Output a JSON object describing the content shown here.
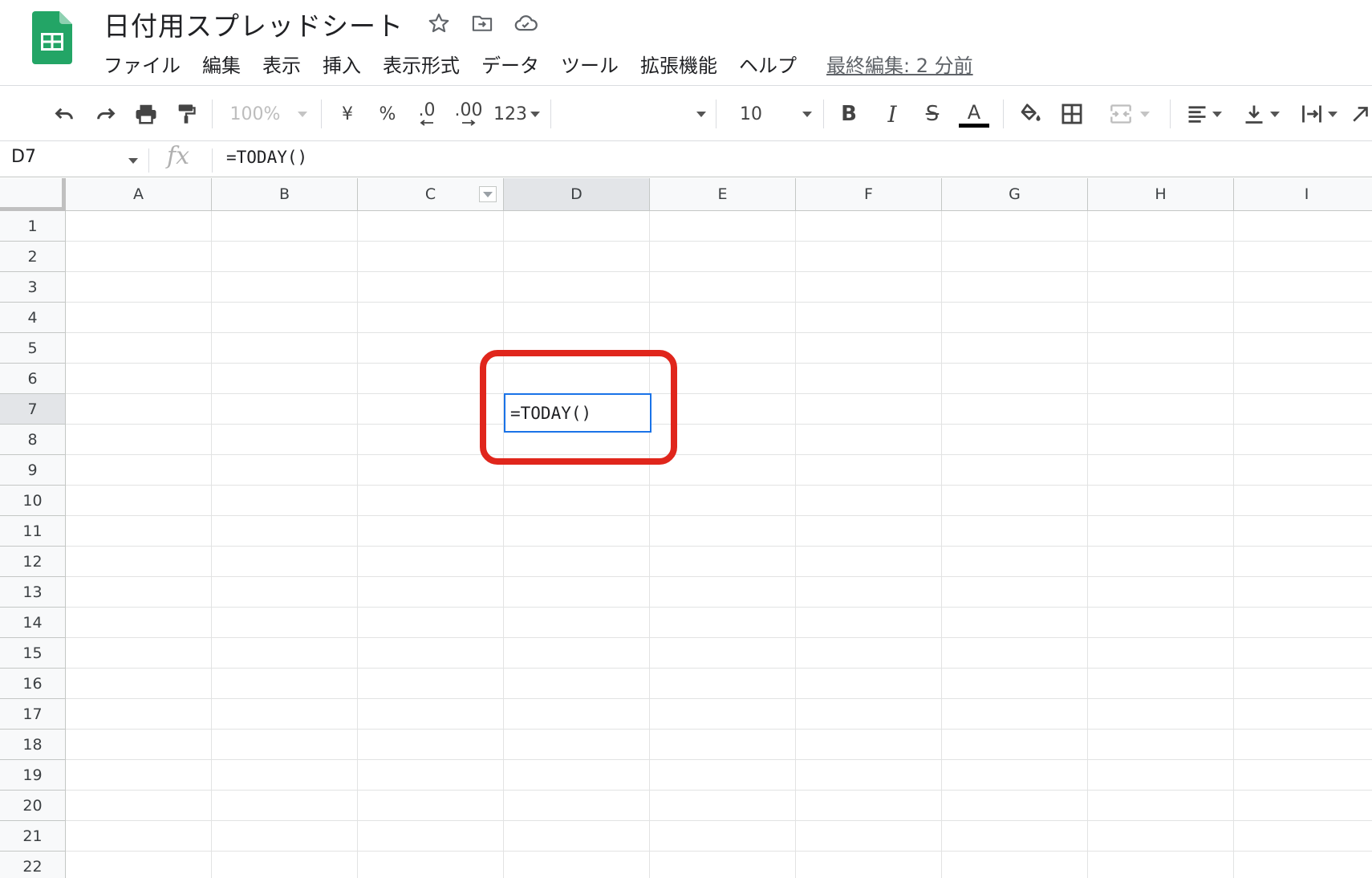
{
  "header": {
    "title": "日付用スプレッドシート",
    "icons": [
      "star-icon",
      "move-to-folder-icon",
      "cloud-saved-icon"
    ],
    "menu": [
      "ファイル",
      "編集",
      "表示",
      "挿入",
      "表示形式",
      "データ",
      "ツール",
      "拡張機能",
      "ヘルプ"
    ],
    "last_edit": "最終編集: 2 分前"
  },
  "toolbar": {
    "zoom": "100%",
    "currency": "¥",
    "percent": "%",
    "decrease_decimal": ".0",
    "increase_decimal": ".00",
    "more_formats": "123",
    "font": "",
    "font_size": "10",
    "bold": "B",
    "italic": "I",
    "strike": "S",
    "text_color": "A"
  },
  "formula_bar": {
    "name_box": "D7",
    "fx": "fx",
    "formula": "=TODAY()"
  },
  "grid": {
    "columns": [
      "A",
      "B",
      "C",
      "D",
      "E",
      "F",
      "G",
      "H",
      "I"
    ],
    "rows": [
      "1",
      "2",
      "3",
      "4",
      "5",
      "6",
      "7",
      "8",
      "9",
      "10",
      "11",
      "12",
      "13",
      "14",
      "15",
      "16",
      "17",
      "18",
      "19",
      "20",
      "21",
      "22"
    ],
    "selected_column": "D",
    "selected_row": "7",
    "active_cell": {
      "ref": "D7",
      "content": "=TODAY()"
    }
  },
  "colors": {
    "sheets_green": "#23a566",
    "selection_blue": "#1a73e8",
    "annotation_red": "#e0261c"
  }
}
